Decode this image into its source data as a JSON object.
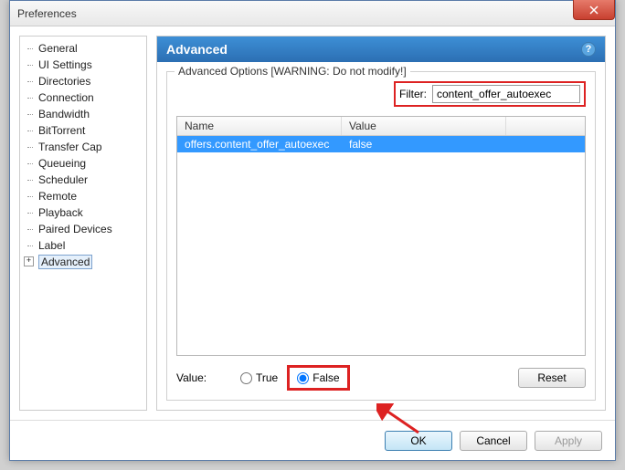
{
  "window": {
    "title": "Preferences"
  },
  "sidebar": {
    "items": [
      {
        "label": "General"
      },
      {
        "label": "UI Settings"
      },
      {
        "label": "Directories"
      },
      {
        "label": "Connection"
      },
      {
        "label": "Bandwidth"
      },
      {
        "label": "BitTorrent"
      },
      {
        "label": "Transfer Cap"
      },
      {
        "label": "Queueing"
      },
      {
        "label": "Scheduler"
      },
      {
        "label": "Remote"
      },
      {
        "label": "Playback"
      },
      {
        "label": "Paired Devices"
      },
      {
        "label": "Label"
      },
      {
        "label": "Advanced"
      }
    ],
    "selected_index": 13
  },
  "panel": {
    "title": "Advanced",
    "group_label": "Advanced Options [WARNING: Do not modify!]",
    "filter_label": "Filter:",
    "filter_value": "content_offer_autoexec",
    "table": {
      "headers": {
        "name": "Name",
        "value": "Value"
      },
      "rows": [
        {
          "name": "offers.content_offer_autoexec",
          "value": "false"
        }
      ],
      "selected_index": 0
    },
    "value_label": "Value:",
    "radio_true": "True",
    "radio_false": "False",
    "selected_radio": "false",
    "reset_label": "Reset"
  },
  "buttons": {
    "ok": "OK",
    "cancel": "Cancel",
    "apply": "Apply"
  }
}
